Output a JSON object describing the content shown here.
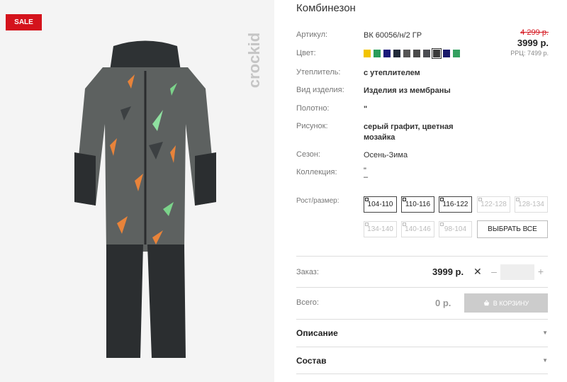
{
  "badge": "SALE",
  "brand": "crockid",
  "product": {
    "title": "Комбинезон",
    "attrs": [
      {
        "label": "Артикул:",
        "value": "ВК 60056/н/2 ГР"
      },
      {
        "label": "Цвет:",
        "value": ""
      },
      {
        "label": "Утеплитель:",
        "value": "с утеплителем"
      },
      {
        "label": "Вид изделия:",
        "value": "Изделия из мембраны"
      },
      {
        "label": "Полотно:",
        "value": "\""
      },
      {
        "label": "Рисунок:",
        "value": "серый графит, цветная мозайка"
      },
      {
        "label": "Сезон:",
        "value": "Осень-Зима"
      },
      {
        "label": "Коллекция:",
        "value": "\"\n–"
      }
    ],
    "swatches": [
      {
        "color": "#f2c400",
        "selected": false
      },
      {
        "color": "#2a9d5a",
        "selected": false
      },
      {
        "color": "#1a1a7a",
        "selected": false
      },
      {
        "color": "#222b3a",
        "selected": false
      },
      {
        "color": "#555555",
        "selected": false
      },
      {
        "color": "#4a4a4a",
        "selected": false
      },
      {
        "color": "#4b4d52",
        "selected": false
      },
      {
        "color": "#3a3a3a",
        "selected": true
      },
      {
        "color": "#1a1a6a",
        "selected": false
      },
      {
        "color": "#34a060",
        "selected": false
      }
    ]
  },
  "price": {
    "old": "4 299 р.",
    "current": "3999 р.",
    "rrp": "РРЦ: 7499 р."
  },
  "sizes": {
    "label": "Рост/размер:",
    "items": [
      {
        "label": "104-110",
        "disabled": false
      },
      {
        "label": "110-116",
        "disabled": false
      },
      {
        "label": "116-122",
        "disabled": false
      },
      {
        "label": "122-128",
        "disabled": true
      },
      {
        "label": "128-134",
        "disabled": true
      },
      {
        "label": "134-140",
        "disabled": true
      },
      {
        "label": "140-146",
        "disabled": true
      },
      {
        "label": "98-104",
        "disabled": true
      }
    ],
    "select_all": "ВЫБРАТЬ ВСЕ"
  },
  "order": {
    "label": "Заказ:",
    "price": "3999 р.",
    "minus": "–",
    "plus": "+",
    "qty": ""
  },
  "total": {
    "label": "Всего:",
    "price": "0 р.",
    "cart_button": "В КОРЗИНУ"
  },
  "accordions": [
    {
      "label": "Описание"
    },
    {
      "label": "Состав"
    }
  ],
  "icons": [
    "close-icon",
    "basket-icon",
    "caret-down-icon"
  ]
}
